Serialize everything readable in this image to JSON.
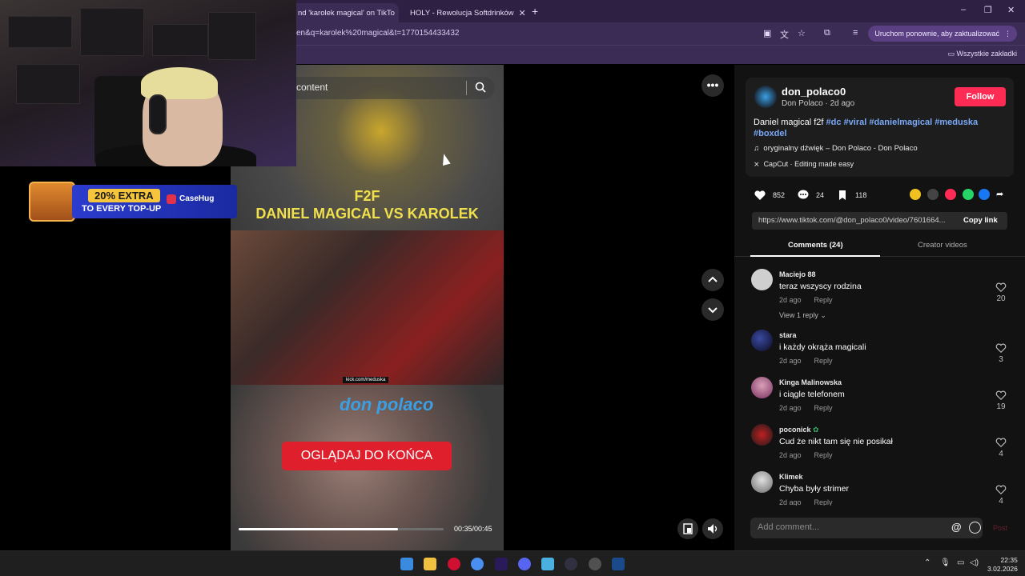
{
  "browser": {
    "tabs": [
      {
        "label": "nd 'karolek magical' on TikTo",
        "active": true
      },
      {
        "label": "HOLY - Rewolucja Softdrinków",
        "active": false
      }
    ],
    "url": "en&q=karolek%20magical&t=1770154433432",
    "update_button": "Uruchom ponownie, aby zaktualizować",
    "bookmarks_label": "Wszystkie zakładki"
  },
  "search": {
    "text": "content"
  },
  "ad": {
    "extra": "20% EXTRA",
    "top_up": "TO EVERY TOP-UP",
    "brand": "CaseHug"
  },
  "video": {
    "title_line1": "F2F",
    "title_line2": "DANIEL MAGICAL VS KAROLEK",
    "kick_tag": "kick.com/meduska",
    "logo_text": "don polaco",
    "cta": "OGLĄDAJ DO KOŃCA",
    "time": "00:35/00:45",
    "progress": 0.7778
  },
  "post": {
    "username": "don_polaco0",
    "display": "Don Polaco · 2d ago",
    "follow_label": "Follow",
    "caption_prefix": "Daniel magical f2f",
    "hashtags": [
      "#dc",
      "#viral",
      "#danielmagical",
      "#meduska",
      "#boxdel"
    ],
    "music": "oryginalny dźwięk – Don Polaco - Don Polaco",
    "capcut": "CapCut · Editing made easy",
    "likes": "852",
    "comments_count": "24",
    "saves": "118",
    "link": "https://www.tiktok.com/@don_polaco0/video/7601664...",
    "copy_link": "Copy link"
  },
  "panel_tabs": {
    "comments": "Comments (24)",
    "creator": "Creator videos"
  },
  "comments": [
    {
      "user": "Maciejo 88",
      "text": "teraz wszyscy rodzina",
      "time": "2d ago",
      "reply": "Reply",
      "likes": "20",
      "view_replies": "View 1 reply"
    },
    {
      "user": "stara",
      "text": "i każdy okrąża magicali",
      "time": "2d ago",
      "reply": "Reply",
      "likes": "3"
    },
    {
      "user": "Kinga Malinowska",
      "text": "i ciągle telefonem",
      "time": "2d ago",
      "reply": "Reply",
      "likes": "19"
    },
    {
      "user": "poconick",
      "text": "Cud że nikt tam się nie posikał",
      "time": "2d ago",
      "reply": "Reply",
      "likes": "4"
    },
    {
      "user": "Klimek",
      "text": "Chyba były strimer",
      "time": "2d ago",
      "reply": "Reply",
      "likes": "4"
    }
  ],
  "comment_input": {
    "placeholder": "Add comment...",
    "at": "@",
    "post": "Post"
  },
  "clock": {
    "time": "22:35",
    "date": "3.02.2026"
  },
  "colors": {
    "accent": "#fe2c55",
    "hashtag": "#7aa9f7",
    "chrome": "#3b2c55"
  }
}
